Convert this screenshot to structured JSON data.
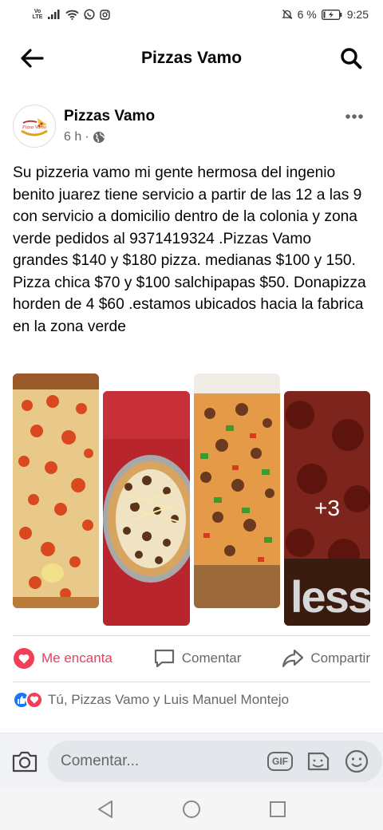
{
  "status_bar": {
    "volte_top": "Vo",
    "volte_bottom": "LTE",
    "battery": "6 %",
    "time": "9:25"
  },
  "header": {
    "title": "Pizzas Vamo"
  },
  "post": {
    "author": "Pizzas Vamo",
    "time": "6 h",
    "separator": "·",
    "avatar_logo_text": "Pizzas Vamo",
    "text": "Su pizzeria vamo  mi gente hermosa  del ingenio benito juarez  tiene servicio a partir de las 12 a las 9 con servicio a  domicilio dentro de la colonia y zona  verde  pedidos al 9371419324 .Pizzas Vamo grandes $140 y $180 pizza. medianas $100 y 150. Pizza chica $70 y $100 salchipapas  $50. Donapizza horden de 4 $60 .estamos ubicados hacia la fabrica en la zona verde",
    "more_photos": "+3",
    "photo4_overlay_text": "less"
  },
  "actions": {
    "like": "Me encanta",
    "comment": "Comentar",
    "share": "Compartir"
  },
  "reactions": {
    "text": "Tú, Pizzas Vamo y Luis Manuel Montejo"
  },
  "composer": {
    "placeholder": "Comentar...",
    "gif": "GIF"
  },
  "colors": {
    "love": "#f33e58",
    "like": "#1877f2",
    "secondary_text": "#65676b"
  }
}
